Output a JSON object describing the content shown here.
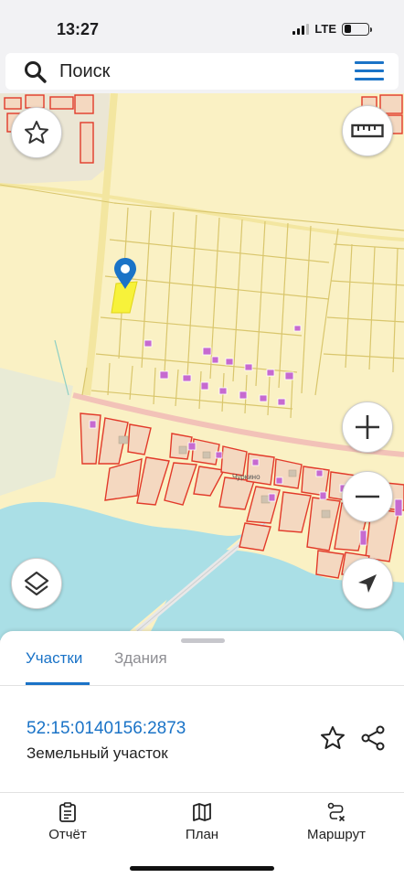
{
  "status_bar": {
    "time": "13:27",
    "network": "LTE",
    "battery_level": 0.3
  },
  "search": {
    "placeholder": "Поиск",
    "icon": "search-icon",
    "menu_icon": "menu-icon"
  },
  "map": {
    "place_label": "Чуркино",
    "buttons": {
      "favorite": "star-icon",
      "ruler": "ruler-icon",
      "zoom_in": "plus-icon",
      "zoom_out": "minus-icon",
      "layers": "layers-icon",
      "locate": "navigation-arrow-icon"
    },
    "colors": {
      "land": "#faf1c4",
      "water": "#aadfe6",
      "parcel_border": "#d9c66c",
      "selected_parcel": "#f7f23a",
      "zone_border": "#e23a2a",
      "zone_fill": "#f4d8c0",
      "building": "#c66ad0",
      "marker": "#1a73c7"
    }
  },
  "sheet": {
    "tabs": [
      {
        "label": "Участки",
        "active": true
      },
      {
        "label": "Здания",
        "active": false
      }
    ],
    "parcel": {
      "number": "52:15:0140156:2873",
      "type": "Земельный участок"
    }
  },
  "nav": {
    "items": [
      {
        "label": "Отчёт",
        "icon": "report-icon"
      },
      {
        "label": "План",
        "icon": "map-plan-icon"
      },
      {
        "label": "Маршрут",
        "icon": "route-icon"
      }
    ]
  }
}
